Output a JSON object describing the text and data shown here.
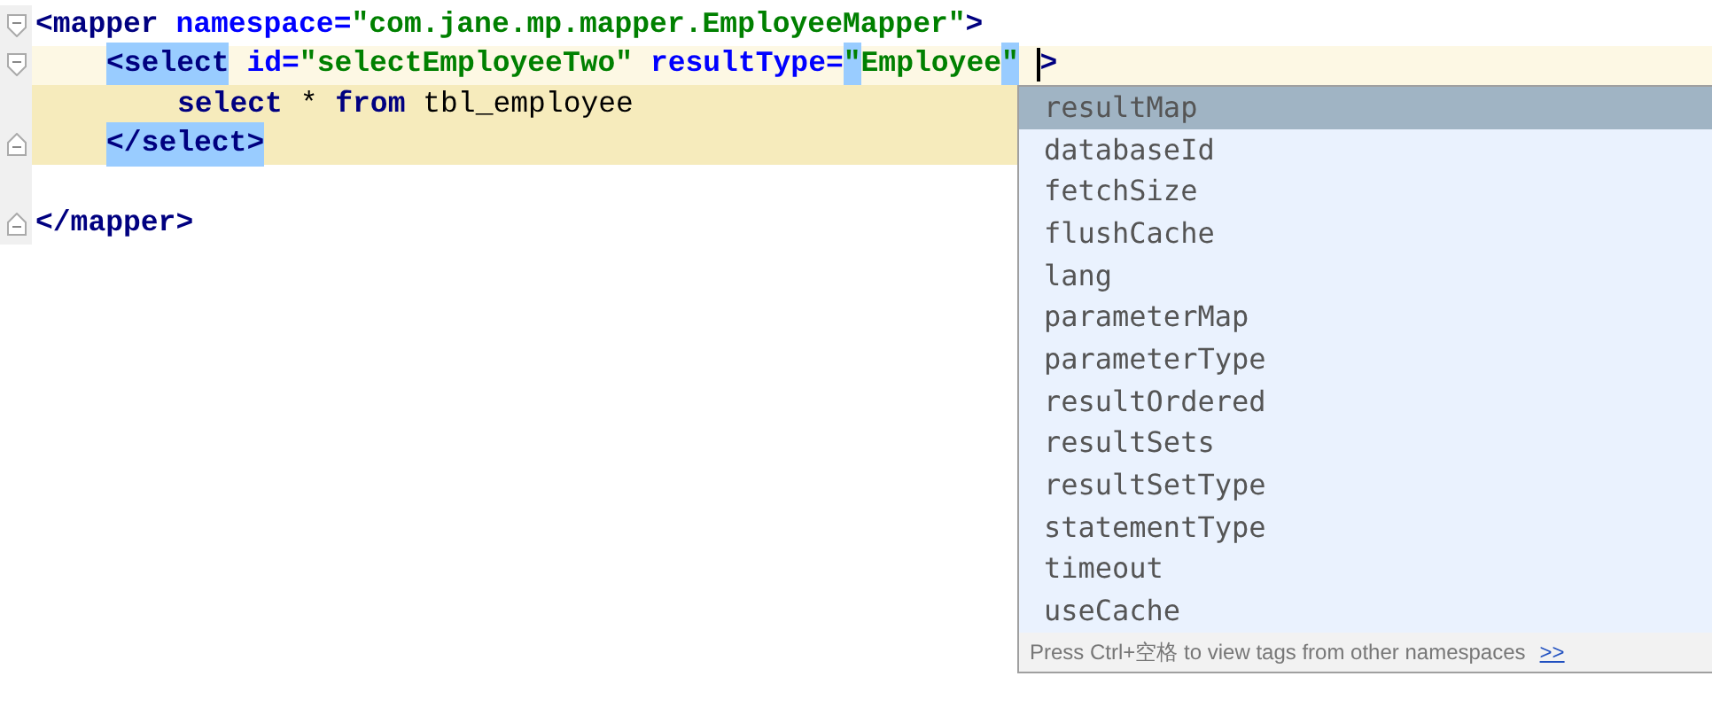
{
  "editor": {
    "lines": [
      {
        "kind": "open_tag",
        "current": false,
        "in_block": false,
        "blank_before": false,
        "words": [
          [
            {
              "kind": "tag",
              "text": "<mapper",
              "matched": false
            }
          ],
          [
            {
              "kind": "attr",
              "text": "namespace="
            },
            {
              "kind": "value",
              "text": "\"com.jane.mp.mapper.EmployeeMapper\"",
              "matched": false
            },
            {
              "kind": "tag",
              "text": ">",
              "matched": false
            }
          ]
        ],
        "children": [
          {
            "kind": "open_tag",
            "current": true,
            "in_block": false,
            "blank_before": false,
            "words": [
              [
                {
                  "kind": "tag",
                  "text": "<select",
                  "matched": true
                }
              ],
              [
                {
                  "kind": "attr",
                  "text": "id="
                },
                {
                  "kind": "value",
                  "text": "\"selectEmployeeTwo\"",
                  "matched": false
                }
              ],
              [
                {
                  "kind": "attr",
                  "text": "resultType="
                },
                {
                  "kind": "value",
                  "text": "\"",
                  "matched": true
                },
                {
                  "kind": "value",
                  "text": "Employee",
                  "matched": false
                },
                {
                  "kind": "value",
                  "text": "\"",
                  "matched": true
                }
              ],
              [
                {
                  "kind": "caret"
                },
                {
                  "kind": "tag",
                  "text": ">",
                  "matched": false
                }
              ]
            ],
            "children": [
              {
                "current": false,
                "in_block": true,
                "blank_before": false,
                "words": [
                  [
                    {
                      "kind": "keyword",
                      "text": "select"
                    }
                  ],
                  [
                    {
                      "kind": "text",
                      "text": "*"
                    }
                  ],
                  [
                    {
                      "kind": "keyword",
                      "text": "from"
                    }
                  ],
                  [
                    {
                      "kind": "text",
                      "text": "tbl_employee"
                    }
                  ]
                ]
              }
            ]
          },
          {
            "kind": "close_tag",
            "current": false,
            "in_block": true,
            "blank_before": false,
            "words": [
              [
                {
                  "kind": "tag",
                  "text": "</select>",
                  "matched": true
                }
              ]
            ]
          }
        ]
      },
      {
        "kind": "close_tag",
        "current": false,
        "in_block": false,
        "blank_before": true,
        "words": [
          [
            {
              "kind": "tag",
              "text": "</mapper>",
              "matched": false
            }
          ]
        ]
      }
    ]
  },
  "completion": {
    "items": [
      {
        "label": "resultMap",
        "selected": true
      },
      {
        "label": "databaseId",
        "selected": false
      },
      {
        "label": "fetchSize",
        "selected": false
      },
      {
        "label": "flushCache",
        "selected": false
      },
      {
        "label": "lang",
        "selected": false
      },
      {
        "label": "parameterMap",
        "selected": false
      },
      {
        "label": "parameterType",
        "selected": false
      },
      {
        "label": "resultOrdered",
        "selected": false
      },
      {
        "label": "resultSets",
        "selected": false
      },
      {
        "label": "resultSetType",
        "selected": false
      },
      {
        "label": "statementType",
        "selected": false
      },
      {
        "label": "timeout",
        "selected": false
      },
      {
        "label": "useCache",
        "selected": false
      }
    ],
    "hint": "Press Ctrl+空格 to view tags from other namespaces",
    "hint_link": ">>"
  }
}
